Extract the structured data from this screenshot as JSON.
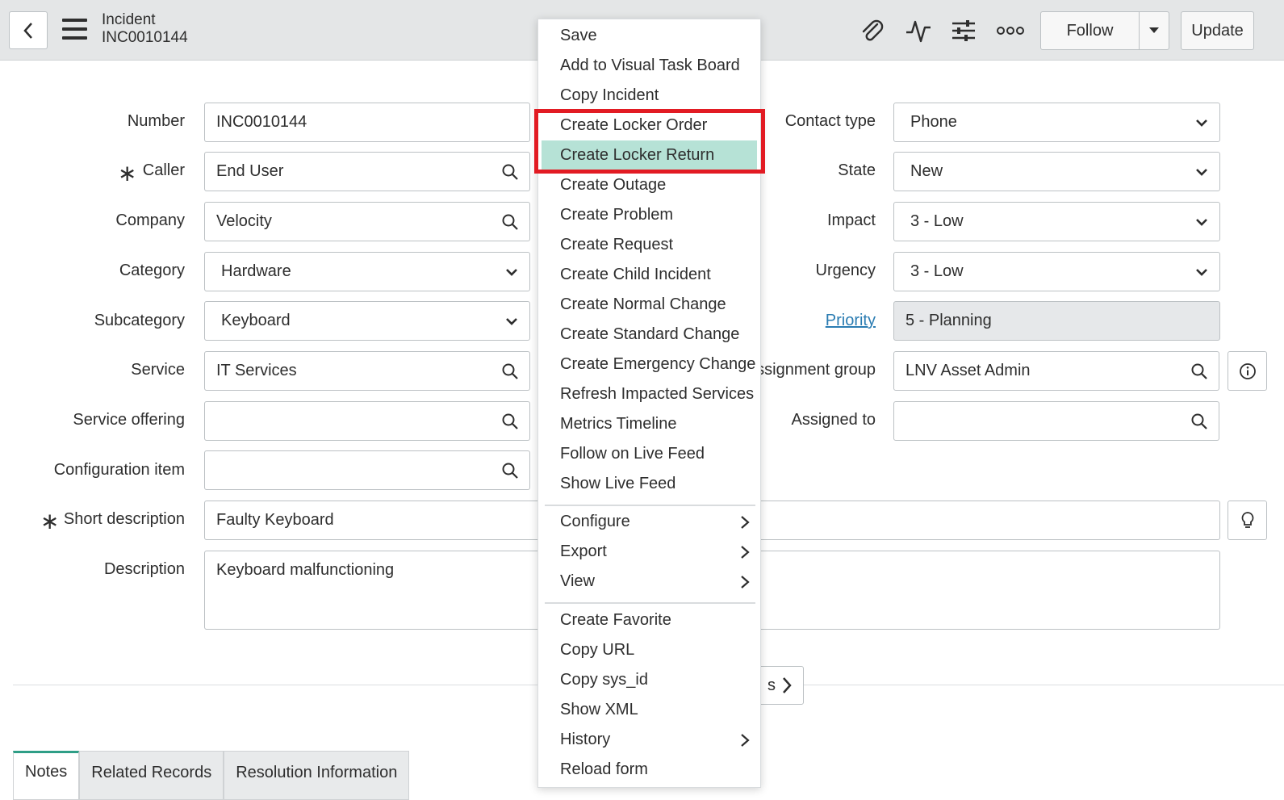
{
  "header": {
    "title": "Incident",
    "number": "INC0010144",
    "follow_label": "Follow",
    "update_label": "Update"
  },
  "form": {
    "number_label": "Number",
    "number_value": "INC0010144",
    "caller_label": "Caller",
    "caller_value": "End User",
    "company_label": "Company",
    "company_value": "Velocity",
    "category_label": "Category",
    "category_value": "Hardware",
    "subcategory_label": "Subcategory",
    "subcategory_value": "Keyboard",
    "service_label": "Service",
    "service_value": "IT Services",
    "service_offering_label": "Service offering",
    "service_offering_value": "",
    "config_item_label": "Configuration item",
    "config_item_value": "",
    "short_desc_label": "Short description",
    "short_desc_value": "Faulty Keyboard",
    "description_label": "Description",
    "description_value": "Keyboard malfunctioning",
    "contact_type_label": "Contact type",
    "contact_type_value": "Phone",
    "state_label": "State",
    "state_value": "New",
    "impact_label": "Impact",
    "impact_value": "3 - Low",
    "urgency_label": "Urgency",
    "urgency_value": "3 - Low",
    "priority_label": "Priority",
    "priority_value": "5 - Planning",
    "assignment_group_label": "ssignment group",
    "assignment_group_value": "LNV Asset Admin",
    "assigned_to_label": "Assigned to",
    "assigned_to_value": "",
    "required_mark": "∗"
  },
  "partial_button_text": "s",
  "tabs": [
    "Notes",
    "Related Records",
    "Resolution Information"
  ],
  "menu": {
    "items": [
      "Save",
      "Add to Visual Task Board",
      "Copy Incident",
      "Create Locker Order",
      "Create Locker Return",
      "Create Outage",
      "Create Problem",
      "Create Request",
      "Create Child Incident",
      "Create Normal Change",
      "Create Standard Change",
      "Create Emergency Change",
      "Refresh Impacted Services",
      "Metrics Timeline",
      "Follow on Live Feed",
      "Show Live Feed"
    ],
    "submenus": [
      "Configure",
      "Export",
      "View"
    ],
    "tail": [
      "Create Favorite",
      "Copy URL",
      "Copy sys_id",
      "Show XML",
      "History",
      "Reload form"
    ],
    "highlighted": "Create Locker Return"
  },
  "icons": {
    "back": "chevron-left-icon",
    "menu": "hamburger-icon",
    "attachment": "paperclip-icon",
    "activity": "activity-pulse-icon",
    "personalize": "sliders-icon",
    "more": "more-options-icon",
    "dropdown": "caret-down-icon",
    "lookup": "search-icon",
    "info": "info-icon",
    "suggest": "lightbulb-icon"
  },
  "colors": {
    "header_bg": "#e4e6e7",
    "highlight_row": "#b6e2d6",
    "highlight_box": "#e21b23",
    "link": "#2a7cb2",
    "tab_accent": "#2e9e86"
  }
}
